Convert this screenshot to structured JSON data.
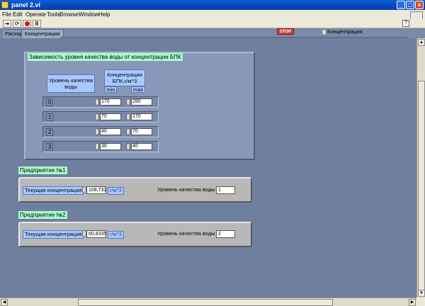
{
  "window": {
    "title": "panel 2.vi"
  },
  "menu": [
    "File",
    "Edit",
    "Operate",
    "Tools",
    "Browse",
    "Window",
    "Help"
  ],
  "tabs": [
    "Расход",
    "Концентрация"
  ],
  "stop_label": "STOP",
  "selector_label": "Концентрация",
  "table": {
    "caption": "Зависимость уровня качества воды от концентрации БПК",
    "col_quality": "Уровень качества воды",
    "col_conc": "Концентрация БПК,г/м^3",
    "col_min": "min",
    "col_max": "max",
    "rows": [
      {
        "level": "0",
        "min": "170",
        "max": "280"
      },
      {
        "level": "1",
        "min": "70",
        "max": "170"
      },
      {
        "level": "2",
        "min": "40",
        "max": "70"
      },
      {
        "level": "3",
        "min": "30",
        "max": "40"
      }
    ]
  },
  "enterprises": [
    {
      "caption": "Предприятие №1",
      "conc_label": "Текущая концентрация",
      "conc_value": "108,732",
      "unit": "г/м^3",
      "quality_label": "Уровень качества воды",
      "quality_value": "1"
    },
    {
      "caption": "Предприятие №2",
      "conc_label": "Текущая концентрация",
      "conc_value": "60,8335",
      "unit": "г/м^3",
      "quality_label": "Уровень качества воды",
      "quality_value": "2"
    }
  ]
}
